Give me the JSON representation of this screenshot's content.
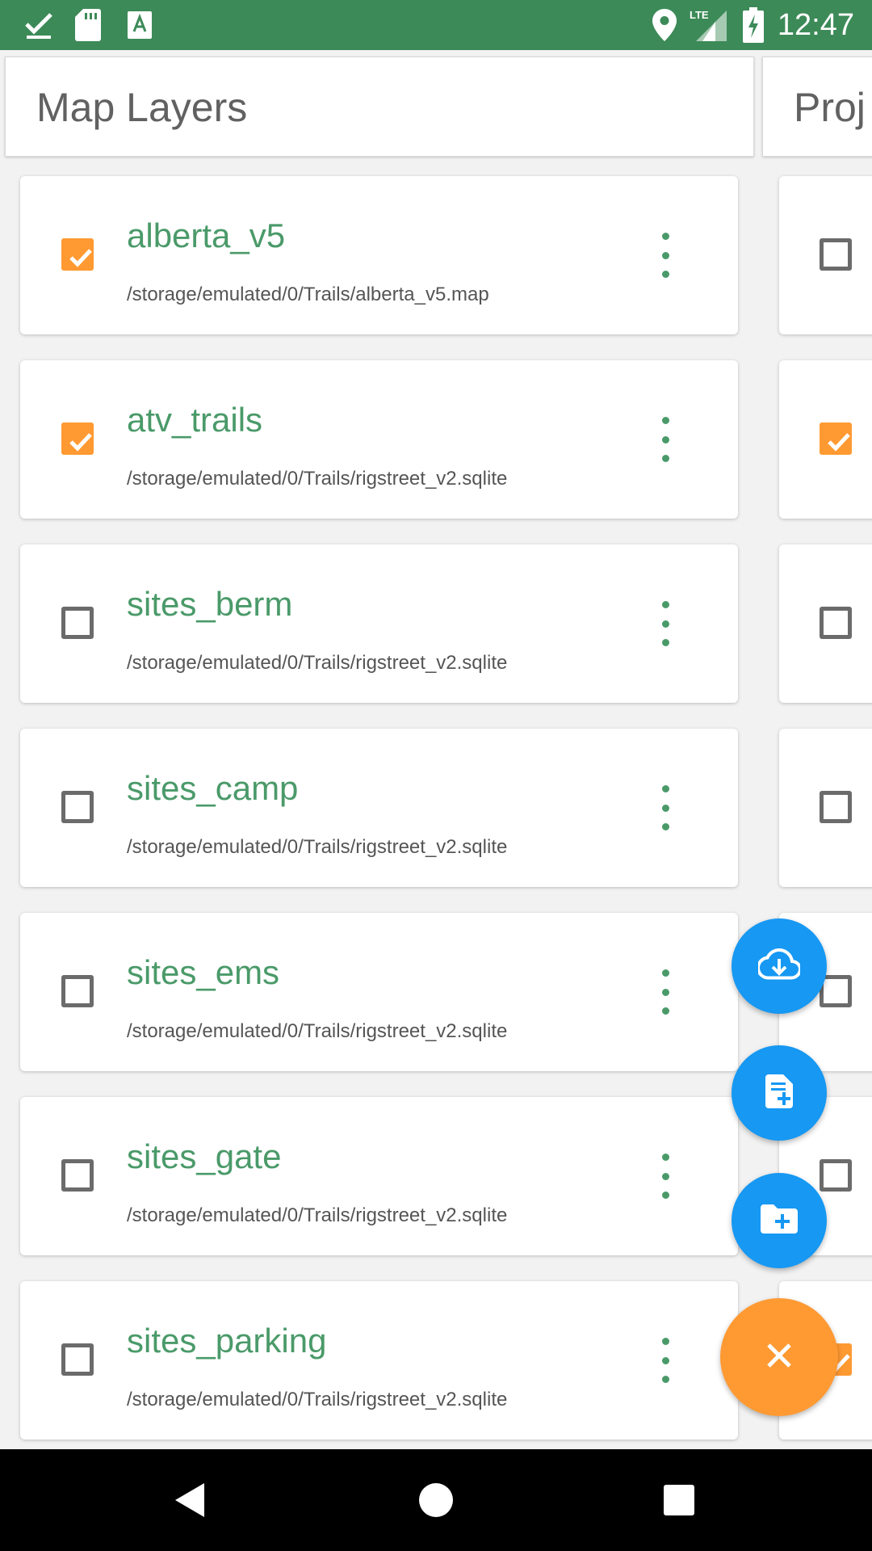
{
  "status_bar": {
    "time": "12:47",
    "network": "LTE",
    "left_icons": [
      "check-icon",
      "sd-card-icon",
      "font-a-icon"
    ],
    "right_icons": [
      "location-pin-icon",
      "lte-signal-icon",
      "battery-charging-icon"
    ]
  },
  "tabs": [
    {
      "title": "Map Layers"
    },
    {
      "title": "Proj"
    }
  ],
  "layers": [
    {
      "name": "alberta_v5",
      "path": "/storage/emulated/0/Trails/alberta_v5.map",
      "checked": true
    },
    {
      "name": "atv_trails",
      "path": "/storage/emulated/0/Trails/rigstreet_v2.sqlite",
      "checked": true
    },
    {
      "name": "sites_berm",
      "path": "/storage/emulated/0/Trails/rigstreet_v2.sqlite",
      "checked": false
    },
    {
      "name": "sites_camp",
      "path": "/storage/emulated/0/Trails/rigstreet_v2.sqlite",
      "checked": false
    },
    {
      "name": "sites_ems",
      "path": "/storage/emulated/0/Trails/rigstreet_v2.sqlite",
      "checked": false
    },
    {
      "name": "sites_gate",
      "path": "/storage/emulated/0/Trails/rigstreet_v2.sqlite",
      "checked": false
    },
    {
      "name": "sites_parking",
      "path": "/storage/emulated/0/Trails/rigstreet_v2.sqlite",
      "checked": false
    }
  ],
  "second_panel_checks": [
    false,
    true,
    false,
    false,
    false,
    false,
    true
  ],
  "fabs": [
    {
      "icon": "cloud-download-icon"
    },
    {
      "icon": "add-file-icon"
    },
    {
      "icon": "add-folder-icon"
    },
    {
      "icon": "close-icon"
    }
  ],
  "colors": {
    "status_bar": "#3c8a58",
    "accent_green": "#4a9a69",
    "checkbox_orange": "#ff9a33",
    "fab_blue": "#1698f3"
  },
  "nav": [
    "back-icon",
    "home-icon",
    "recents-icon"
  ]
}
